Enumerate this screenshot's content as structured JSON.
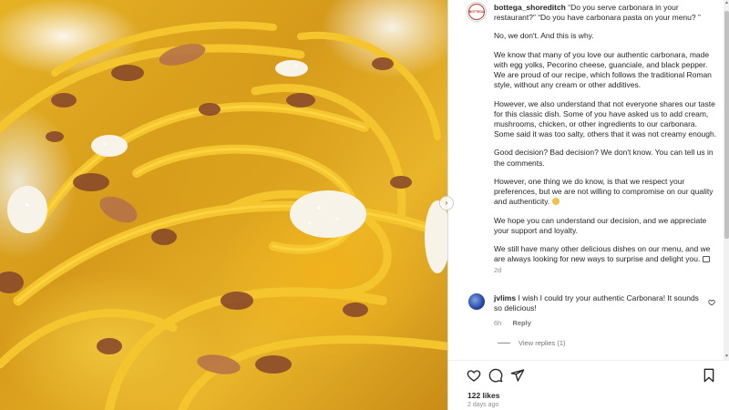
{
  "post": {
    "username": "bottega_shoreditch",
    "avatar_text": "BOTTEGA",
    "caption": [
      "“Do you serve carbonara in your restaurant?” “Do you have carbonara pasta on your menu? ”",
      "No, we don't. And this is why.",
      "We know that many of you love our authentic carbonara, made with egg yolks, Pecorino cheese, guanciale, and black pepper. We are proud of our recipe, which follows the traditional Roman style, without any cream or other additives.",
      "However, we also understand that not everyone shares our taste for this classic dish. Some of you have asked us to add cream, mushrooms, chicken, or other ingredients to our carbonara. Some said it was too salty, others that it was not creamy enough.",
      "Good decision? Bad decision? We don't know. You can tell us in the comments.",
      "However, one thing we do know, is that we respect your preferences, but we are not willing to compromise on our quality and authenticity.",
      "We hope you can understand our decision, and we appreciate your support and loyalty.",
      "We still have many other delicious dishes on our menu, and we are always looking for new ways to surprise and delight you."
    ],
    "time": "2d"
  },
  "comment": {
    "username": "jvlims",
    "text": "I wish I could try your authentic Carbonara! It sounds so delicious!",
    "time": "6h",
    "reply_label": "Reply",
    "view_replies": "View replies (1)"
  },
  "footer": {
    "likes": "122 likes",
    "date": "2 days ago"
  },
  "icons": {
    "like": "heart-icon",
    "comment": "comment-icon",
    "share": "share-icon",
    "save": "bookmark-icon",
    "next": "chevron-right-icon"
  },
  "colors": {
    "text": "#262626",
    "muted": "#8e8e8e",
    "divider": "#dbdbdb",
    "brand_ring": "#c0392b"
  }
}
